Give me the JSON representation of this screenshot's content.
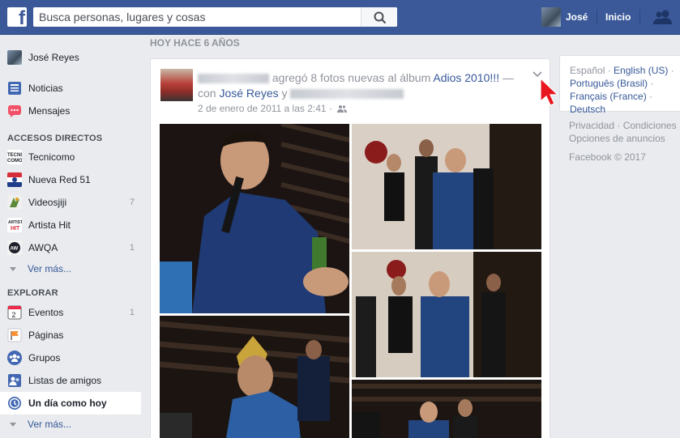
{
  "topbar": {
    "logo_letter": "f",
    "search_placeholder": "Busca personas, lugares y cosas",
    "user_name": "José",
    "home_label": "Inicio"
  },
  "sidebar": {
    "profile_name": "José Reyes",
    "main_items": [
      {
        "label": "Noticias",
        "icon": "news-feed-icon"
      },
      {
        "label": "Mensajes",
        "icon": "messages-icon"
      }
    ],
    "shortcuts_header": "ACCESOS DIRECTOS",
    "shortcuts": [
      {
        "label": "Tecnicomo",
        "count": "",
        "icon": "tecnicomo-icon"
      },
      {
        "label": "Nueva Red 51",
        "count": "",
        "icon": "nueva-red-icon"
      },
      {
        "label": "Videosjiji",
        "count": "7",
        "icon": "videosjiji-icon"
      },
      {
        "label": "Artista Hit",
        "count": "",
        "icon": "artista-hit-icon"
      },
      {
        "label": "AWQA",
        "count": "1",
        "icon": "awqa-icon"
      }
    ],
    "see_more_1": "Ver más...",
    "explore_header": "EXPLORAR",
    "explore": [
      {
        "label": "Eventos",
        "count": "1",
        "icon": "events-icon"
      },
      {
        "label": "Páginas",
        "count": "",
        "icon": "pages-icon"
      },
      {
        "label": "Grupos",
        "count": "",
        "icon": "groups-icon"
      },
      {
        "label": "Listas de amigos",
        "count": "",
        "icon": "friend-lists-icon"
      },
      {
        "label": "Un día como hoy",
        "count": "",
        "icon": "on-this-day-icon"
      }
    ],
    "see_more_2": "Ver más..."
  },
  "main": {
    "section_title": "HOY HACE 6 AÑOS",
    "post": {
      "action_text": " agregó 8 fotos nuevas al álbum ",
      "album_name": "Adios 2010!!!",
      "with_text": " — con ",
      "tagged_name": "José Reyes",
      "and_text": " y ",
      "date": "2 de enero de 2011 a las 2:41 ·"
    }
  },
  "right": {
    "languages": {
      "current": "Español",
      "links": [
        "English (US)",
        "Português (Brasil)",
        "Français (France)",
        "Deutsch"
      ]
    },
    "footer_line1": "Privacidad · Condiciones ·",
    "footer_line2": "Opciones de anuncios",
    "copyright": "Facebook © 2017"
  },
  "colors": {
    "brand_blue": "#3b5998",
    "link_blue": "#365899",
    "muted_text": "#90949c",
    "background": "#e9ebee"
  }
}
